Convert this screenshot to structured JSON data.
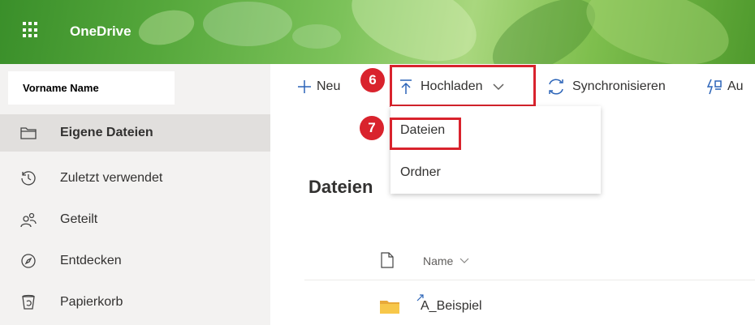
{
  "app": {
    "title": "OneDrive"
  },
  "user": {
    "name": "Vorname Name"
  },
  "sidebar": {
    "items": [
      {
        "label": "Eigene Dateien",
        "icon": "folder-icon",
        "selected": true
      },
      {
        "label": "Zuletzt verwendet",
        "icon": "clock-icon"
      },
      {
        "label": "Geteilt",
        "icon": "people-icon"
      },
      {
        "label": "Entdecken",
        "icon": "compass-icon"
      },
      {
        "label": "Papierkorb",
        "icon": "recycle-bin-icon"
      }
    ]
  },
  "toolbar": {
    "new_label": "Neu",
    "upload_label": "Hochladen",
    "sync_label": "Synchronisieren",
    "automate_label": "Au"
  },
  "upload_menu": {
    "items": [
      {
        "label": "Dateien"
      },
      {
        "label": "Ordner"
      }
    ]
  },
  "callouts": {
    "step6": "6",
    "step7": "7"
  },
  "main": {
    "title": "Dateien",
    "columns": {
      "name_header": "Name"
    },
    "rows": [
      {
        "name": "A_Beispiel",
        "type": "folder"
      }
    ]
  },
  "colors": {
    "accent": "#0078d4",
    "highlight": "#d9232d",
    "banner": "#56a83c"
  }
}
